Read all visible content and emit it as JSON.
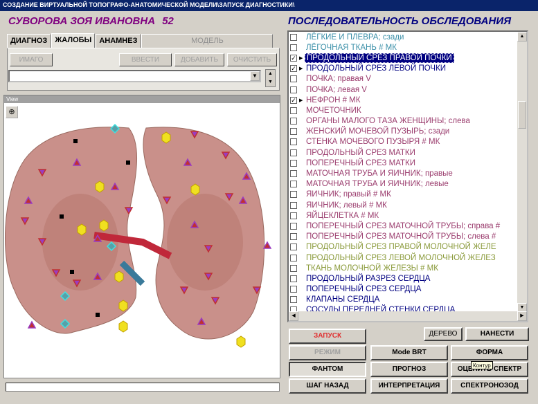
{
  "window": {
    "title": "СОЗДАНИЕ ВИРТУАЛЬНОЙ ТОПОГРАФО-АНАТОМИЧЕСКОЙ МОДЕЛИ\\ЗАПУСК ДИАГНОСТИКИ\\"
  },
  "patient": {
    "name": "СУВОРОВА ЗОЯ ИВАНОВНА",
    "age": "52"
  },
  "tabs": [
    {
      "label": "ДИАГНОЗ",
      "active": false,
      "enabled": true
    },
    {
      "label": "ЖАЛОБЫ",
      "active": true,
      "enabled": true
    },
    {
      "label": "АНАМНЕЗ",
      "active": false,
      "enabled": true
    },
    {
      "label": "МОДЕЛЬ",
      "active": false,
      "enabled": false
    }
  ],
  "complaints_toolbar": {
    "imago": "ИМАГО",
    "enter": "ВВЕСТИ",
    "add": "ДОБАВИТЬ",
    "clear": "ОЧИСТИТЬ"
  },
  "view": {
    "label": "View",
    "zoom_icon": "magnifier-plus-icon"
  },
  "sequence": {
    "title": "ПОСЛЕДОВАТЕЛЬНОСТЬ ОБСЛЕДОВАНИЯ",
    "items": [
      {
        "label": "ЛЁГКИЕ И ПЛЕВРА; сзади",
        "checked": false,
        "color": "#3a8fa8"
      },
      {
        "label": "ЛЁГОЧНАЯ ТКАНЬ # МК",
        "checked": false,
        "color": "#3a8fa8"
      },
      {
        "label": "ПРОДОЛЬНЫЙ СРЕЗ ПРАВОЙ ПОЧКИ",
        "checked": true,
        "color": "#ffffff",
        "selected": true,
        "marker": true
      },
      {
        "label": "ПРОДОЛЬНЫЙ СРЕЗ ЛЕВОЙ ПОЧКИ",
        "checked": true,
        "color": "#000080",
        "marker": true
      },
      {
        "label": "ПОЧКА; правая V",
        "checked": false,
        "color": "#9b3d6e"
      },
      {
        "label": "ПОЧКА; левая V",
        "checked": false,
        "color": "#9b3d6e"
      },
      {
        "label": "НЕФРОН # МК",
        "checked": true,
        "color": "#9b3d6e",
        "marker": true
      },
      {
        "label": "МОЧЕТОЧНИК",
        "checked": false,
        "color": "#9b3d6e"
      },
      {
        "label": "ОРГАНЫ МАЛОГО ТАЗА ЖЕНЩИНЫ; слева",
        "checked": false,
        "color": "#9b3d6e"
      },
      {
        "label": "ЖЕНСКИЙ МОЧЕВОЙ ПУЗЫРЬ; сзади",
        "checked": false,
        "color": "#9b3d6e"
      },
      {
        "label": "СТЕНКА МОЧЕВОГО ПУЗЫРЯ # МК",
        "checked": false,
        "color": "#9b3d6e"
      },
      {
        "label": "ПРОДОЛЬНЫЙ СРЕЗ МАТКИ",
        "checked": false,
        "color": "#9b3d6e"
      },
      {
        "label": "ПОПЕРЕЧНЫЙ СРЕЗ МАТКИ",
        "checked": false,
        "color": "#9b3d6e"
      },
      {
        "label": "МАТОЧНАЯ ТРУБА И ЯИЧНИК; правые",
        "checked": false,
        "color": "#9b3d6e"
      },
      {
        "label": "МАТОЧНАЯ ТРУБА И ЯИЧНИК; левые",
        "checked": false,
        "color": "#9b3d6e"
      },
      {
        "label": "ЯИЧНИК; правый # МК",
        "checked": false,
        "color": "#9b3d6e"
      },
      {
        "label": "ЯИЧНИК; левый # МК",
        "checked": false,
        "color": "#9b3d6e"
      },
      {
        "label": "ЯЙЦЕКЛЕТКА # МК",
        "checked": false,
        "color": "#9b3d6e"
      },
      {
        "label": "ПОПЕРЕЧНЫЙ СРЕЗ МАТОЧНОЙ ТРУБЫ; справа #",
        "checked": false,
        "color": "#9b3d6e"
      },
      {
        "label": "ПОПЕРЕЧНЫЙ СРЕЗ МАТОЧНОЙ ТРУБЫ; слева #",
        "checked": false,
        "color": "#9b3d6e"
      },
      {
        "label": "ПРОДОЛЬНЫЙ СРЕЗ ПРАВОЙ МОЛОЧНОЙ ЖЕЛЕ",
        "checked": false,
        "color": "#8a9a3a"
      },
      {
        "label": "ПРОДОЛЬНЫЙ СРЕЗ ЛЕВОЙ МОЛОЧНОЙ ЖЕЛЕЗ",
        "checked": false,
        "color": "#8a9a3a"
      },
      {
        "label": "ТКАНЬ МОЛОЧНОЙ ЖЕЛЕЗЫ # МК",
        "checked": false,
        "color": "#8a9a3a"
      },
      {
        "label": "ПРОДОЛЬНЫЙ РАЗРЕЗ СЕРДЦА",
        "checked": false,
        "color": "#000080"
      },
      {
        "label": "ПОПЕРЕЧНЫЙ СРЕЗ СЕРДЦА",
        "checked": false,
        "color": "#000080"
      },
      {
        "label": "КЛАПАНЫ СЕРДЦА",
        "checked": false,
        "color": "#000080"
      },
      {
        "label": "СОСУДЫ ПЕРЕДНЕЙ СТЕНКИ СЕРДЦА",
        "checked": false,
        "color": "#000080"
      }
    ]
  },
  "controls": {
    "tree": "ДЕРЕВО",
    "apply": "НАНЕСТИ",
    "launch": "ЗАПУСК",
    "mode": "РЕЖИМ",
    "phantom": "ФАНТОМ",
    "step_back": "ШАГ НАЗАД",
    "mode_brt": "Mode BRT",
    "prognosis": "ПРОГНОЗ",
    "interpretation": "ИНТЕРПРЕТАЦИЯ",
    "form": "ФОРМА",
    "evaluate_spectrum": "ОЦЕНИТЬ СПЕКТР",
    "spectronosode": "СПЕКТРОНОЗОД",
    "tooltip": "Контур"
  },
  "colors": {
    "launch": "#e03030",
    "disabled": "#a0a0a0",
    "selection": "#000080",
    "title_purple": "#800080"
  }
}
